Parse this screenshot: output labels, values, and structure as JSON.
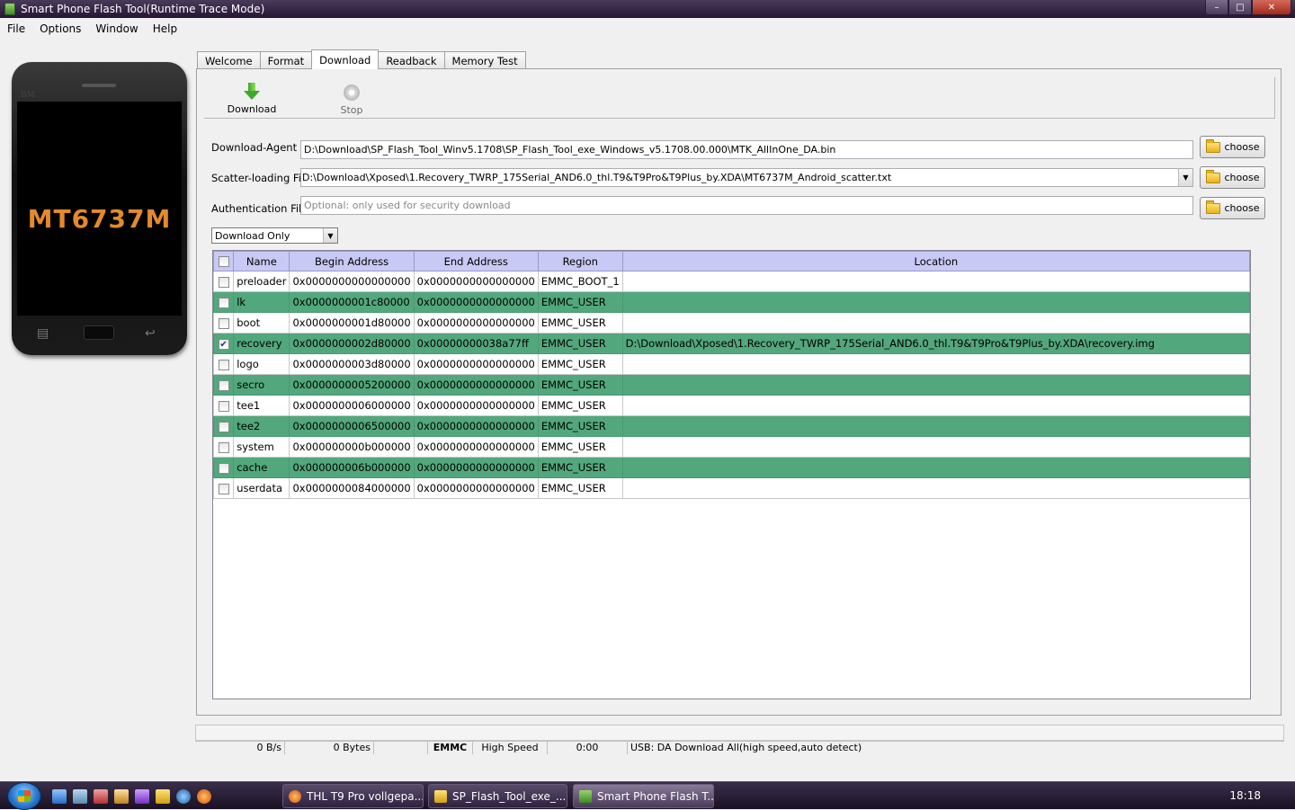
{
  "window": {
    "title": "Smart Phone Flash Tool(Runtime Trace Mode)",
    "minimize": "–",
    "maximize": "□",
    "close": "✕"
  },
  "menu": [
    "File",
    "Options",
    "Window",
    "Help"
  ],
  "phone": {
    "brand": "BM",
    "chip": "MT6737M"
  },
  "tabs": [
    "Welcome",
    "Format",
    "Download",
    "Readback",
    "Memory Test"
  ],
  "active_tab": "Download",
  "toolbar": {
    "download_label": "Download",
    "stop_label": "Stop"
  },
  "form": {
    "download_agent_label": "Download-Agent",
    "download_agent_value": "D:\\Download\\SP_Flash_Tool_Winv5.1708\\SP_Flash_Tool_exe_Windows_v5.1708.00.000\\MTK_AllInOne_DA.bin",
    "scatter_label": "Scatter-loading File",
    "scatter_value": "D:\\Download\\Xposed\\1.Recovery_TWRP_175Serial_AND6.0_thl.T9&T9Pro&T9Plus_by.XDA\\MT6737M_Android_scatter.txt",
    "auth_label": "Authentication File",
    "auth_placeholder": "Optional: only used for security download",
    "choose_label": "choose",
    "mode_value": "Download Only"
  },
  "table": {
    "headers": [
      "Name",
      "Begin Address",
      "End Address",
      "Region",
      "Location"
    ],
    "rows": [
      {
        "checked": false,
        "name": "preloader",
        "begin": "0x0000000000000000",
        "end": "0x0000000000000000",
        "region": "EMMC_BOOT_1",
        "location": ""
      },
      {
        "checked": false,
        "name": "lk",
        "begin": "0x0000000001c80000",
        "end": "0x0000000000000000",
        "region": "EMMC_USER",
        "location": ""
      },
      {
        "checked": false,
        "name": "boot",
        "begin": "0x0000000001d80000",
        "end": "0x0000000000000000",
        "region": "EMMC_USER",
        "location": ""
      },
      {
        "checked": true,
        "name": "recovery",
        "begin": "0x0000000002d80000",
        "end": "0x00000000038a77ff",
        "region": "EMMC_USER",
        "location": "D:\\Download\\Xposed\\1.Recovery_TWRP_175Serial_AND6.0_thl.T9&T9Pro&T9Plus_by.XDA\\recovery.img"
      },
      {
        "checked": false,
        "name": "logo",
        "begin": "0x0000000003d80000",
        "end": "0x0000000000000000",
        "region": "EMMC_USER",
        "location": ""
      },
      {
        "checked": false,
        "name": "secro",
        "begin": "0x0000000005200000",
        "end": "0x0000000000000000",
        "region": "EMMC_USER",
        "location": ""
      },
      {
        "checked": false,
        "name": "tee1",
        "begin": "0x0000000006000000",
        "end": "0x0000000000000000",
        "region": "EMMC_USER",
        "location": ""
      },
      {
        "checked": false,
        "name": "tee2",
        "begin": "0x0000000006500000",
        "end": "0x0000000000000000",
        "region": "EMMC_USER",
        "location": ""
      },
      {
        "checked": false,
        "name": "system",
        "begin": "0x000000000b000000",
        "end": "0x0000000000000000",
        "region": "EMMC_USER",
        "location": ""
      },
      {
        "checked": false,
        "name": "cache",
        "begin": "0x000000006b000000",
        "end": "0x0000000000000000",
        "region": "EMMC_USER",
        "location": ""
      },
      {
        "checked": false,
        "name": "userdata",
        "begin": "0x0000000084000000",
        "end": "0x0000000000000000",
        "region": "EMMC_USER",
        "location": ""
      }
    ]
  },
  "status": {
    "speed": "0 B/s",
    "bytes": "0 Bytes",
    "storage": "EMMC",
    "mode": "High Speed",
    "time": "0:00",
    "usb": "USB: DA Download All(high speed,auto detect)"
  },
  "taskbar": {
    "items": [
      "THL T9 Pro vollgepa...",
      "SP_Flash_Tool_exe_...",
      "Smart Phone Flash T..."
    ],
    "clock": "18:18"
  },
  "colors": {
    "row_highlight": "#52a77c",
    "header_bg": "#c9c9f5",
    "chip_text": "#e38a2a"
  }
}
